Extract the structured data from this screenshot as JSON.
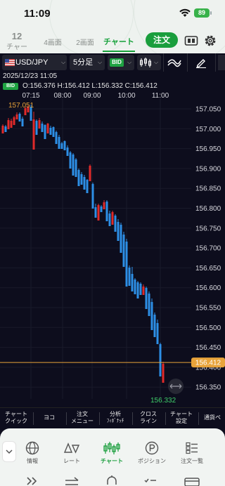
{
  "status_bar": {
    "time": "11:09",
    "battery": "89"
  },
  "top_tabs": [
    {
      "num": "12",
      "label": "チャート"
    },
    {
      "label": "4画面"
    },
    {
      "label": "2画面"
    },
    {
      "label": "チャート"
    }
  ],
  "order_button": "注文",
  "toolbar": {
    "pair": "USD/JPY",
    "interval": "5分足",
    "price_type": "BID"
  },
  "ohlc": {
    "datetime": "2025/12/23 11:05",
    "badge": "BID",
    "values": "O:156.376  H:156.412  L:156.332  C:156.412"
  },
  "chart_data": {
    "type": "candlestick",
    "x_ticks": [
      "07:15",
      "08:00",
      "09:00",
      "10:00",
      "11:00"
    ],
    "y_ticks": [
      "157.050",
      "157.000",
      "156.950",
      "156.900",
      "156.850",
      "156.800",
      "156.750",
      "156.700",
      "156.650",
      "156.600",
      "156.550",
      "156.500",
      "156.450",
      "156.400",
      "156.350"
    ],
    "high_marker": "157.051",
    "low_marker": "156.332",
    "current_price": "156.412",
    "ylim": [
      156.32,
      157.07
    ]
  },
  "tools": [
    {
      "l1": "チャート",
      "l2": "クイック"
    },
    {
      "l1": "ヨコ",
      "l2": ""
    },
    {
      "l1": "注文",
      "l2": "メニュー"
    },
    {
      "l1": "分析",
      "l2": "ﾌｨﾎﾞﾅｯﾁ"
    },
    {
      "l1": "クロス",
      "l2": "ライン"
    },
    {
      "l1": "チャート",
      "l2": "設定"
    },
    {
      "l1": "通貨ペ",
      "l2": ""
    }
  ],
  "bottom_nav": [
    {
      "label": "情報",
      "icon": "globe-icon"
    },
    {
      "label": "レート",
      "icon": "rate-icon"
    },
    {
      "label": "チャート",
      "icon": "candle-icon"
    },
    {
      "label": "ポジション",
      "icon": "position-icon"
    },
    {
      "label": "注文一覧",
      "icon": "list-icon"
    }
  ],
  "colors": {
    "accent": "#1a9e3d",
    "up": "#e02a2a",
    "down": "#2d8fe6",
    "price_line": "#e8a33a"
  }
}
